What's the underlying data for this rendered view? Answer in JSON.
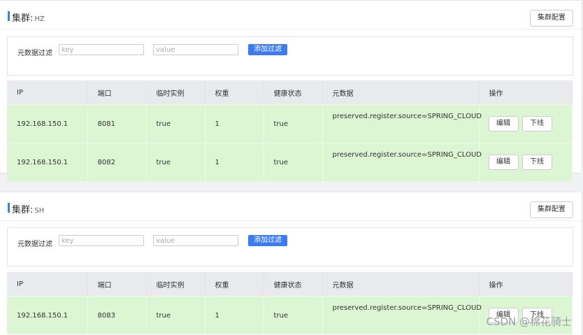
{
  "clusters": [
    {
      "title_prefix": "集群:",
      "name": "HZ",
      "config_button": "集群配置",
      "filter": {
        "label": "元数据过滤",
        "key_placeholder": "key",
        "value_placeholder": "value",
        "add_button": "添加过滤"
      },
      "columns": [
        "IP",
        "端口",
        "临时实例",
        "权重",
        "健康状态",
        "元数据",
        "操作"
      ],
      "rows": [
        {
          "ip": "192.168.150.1",
          "port": "8081",
          "ephemeral": "true",
          "weight": "1",
          "healthy": "true",
          "metadata": "preserved.register.source=SPRING_CLOUD",
          "edit": "编辑",
          "offline": "下线"
        },
        {
          "ip": "192.168.150.1",
          "port": "8082",
          "ephemeral": "true",
          "weight": "1",
          "healthy": "true",
          "metadata": "preserved.register.source=SPRING_CLOUD",
          "edit": "编辑",
          "offline": "下线"
        }
      ]
    },
    {
      "title_prefix": "集群:",
      "name": "SH",
      "config_button": "集群配置",
      "filter": {
        "label": "元数据过滤",
        "key_placeholder": "key",
        "value_placeholder": "value",
        "add_button": "添加过滤"
      },
      "columns": [
        "IP",
        "端口",
        "临时实例",
        "权重",
        "健康状态",
        "元数据",
        "操作"
      ],
      "rows": [
        {
          "ip": "192.168.150.1",
          "port": "8083",
          "ephemeral": "true",
          "weight": "1",
          "healthy": "true",
          "metadata": "preserved.register.source=SPRING_CLOUD",
          "edit": "编辑",
          "offline": "下线"
        }
      ]
    }
  ],
  "watermark": "CSDN @棉花骑士",
  "colors": {
    "accent": "#3d7cf0",
    "row_bg": "#dcf6d4",
    "header_bg": "#e9eaee"
  }
}
